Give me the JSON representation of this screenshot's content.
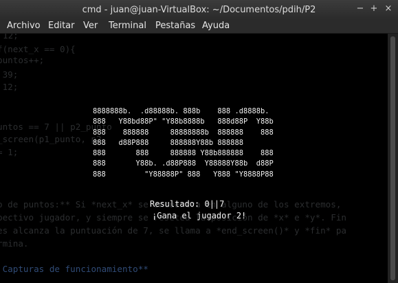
{
  "window": {
    "title": "cmd - juan@juan-VirtualBox: ~/Documentos/pdih/P2",
    "controls": {
      "minimize": "−",
      "maximize": "+",
      "close": "×"
    }
  },
  "menu": [
    "Archivo",
    "Editar",
    "Ver",
    "Terminal",
    "Pestañas",
    "Ayuda"
  ],
  "background_text": {
    "code": [
      "12;",
      "f(next_x == 0){",
      "puntos++;",
      " 39;",
      " 12;",
      "",
      "",
      "untos == 7 || p2_punto",
      "_screen(p1_punto, p2_",
      "= 1;"
    ],
    "doc": [
      "o de puntos:** Si *next_x* se encuentra en alguno de los extremos,",
      "pectivo jugador, y siempre se resetea la posición de *x* e *y*. Fin",
      "es alcanza la puntuación de 7, se llama a *end_screen()* y *fin* pa",
      "rmina.",
      "",
      " Capturas de funcionamiento**"
    ]
  },
  "ascii_art": [
    "8888888b.  .d88888b. 888b    888 .d8888b.",
    "888   Y88bd88P\" \"Y88b8888b   888d88P  Y88b",
    "888    888888     88888888b  888888    888",
    "888   d88P888     888888Y88b 888888",
    "888       888     888888 Y88b888888    888",
    "888       Y88b. .d88P888  Y88888Y88b  d88P",
    "888         \"Y88888P\" 888   Y888 \"Y8888P88"
  ],
  "result": {
    "score_text": "Resultado: 0||7",
    "winner_text": "¡Gana el jugador 2!"
  }
}
